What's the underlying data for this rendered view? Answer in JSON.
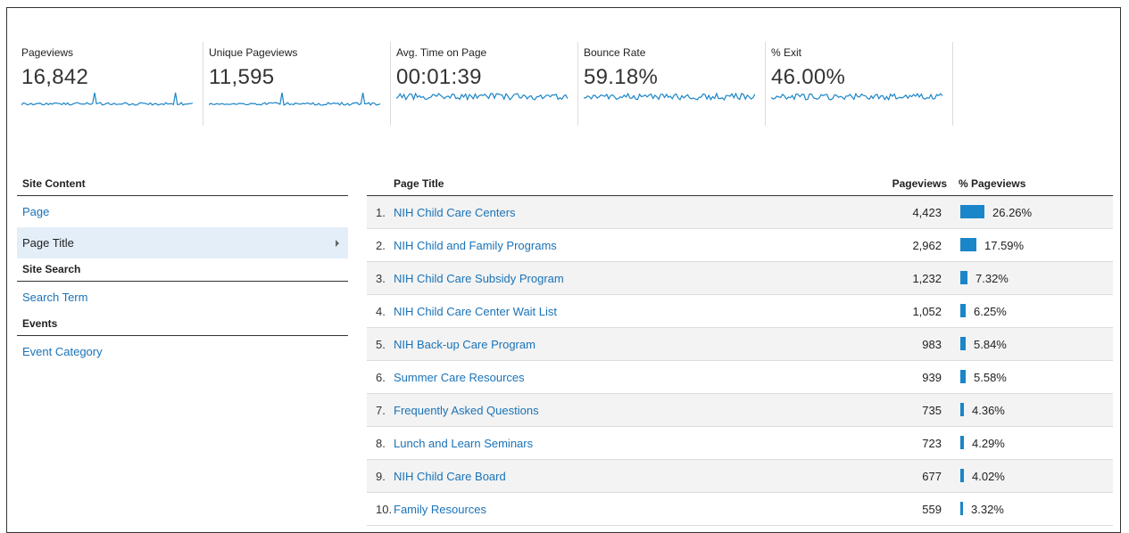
{
  "metrics": [
    {
      "label": "Pageviews",
      "value": "16,842"
    },
    {
      "label": "Unique Pageviews",
      "value": "11,595"
    },
    {
      "label": "Avg. Time on Page",
      "value": "00:01:39"
    },
    {
      "label": "Bounce Rate",
      "value": "59.18%"
    },
    {
      "label": "% Exit",
      "value": "46.00%"
    }
  ],
  "nav": {
    "site_content": "Site Content",
    "page": "Page",
    "page_title": "Page Title",
    "site_search": "Site Search",
    "search_term": "Search Term",
    "events": "Events",
    "event_category": "Event Category"
  },
  "table": {
    "col_title": "Page Title",
    "col_pageviews": "Pageviews",
    "col_pct": "% Pageviews",
    "rows": [
      {
        "num": "1.",
        "title": "NIH Child Care Centers",
        "pageviews": "4,423",
        "pct": "26.26%",
        "share": 26.26
      },
      {
        "num": "2.",
        "title": "NIH Child and Family Programs",
        "pageviews": "2,962",
        "pct": "17.59%",
        "share": 17.59
      },
      {
        "num": "3.",
        "title": "NIH Child Care Subsidy Program",
        "pageviews": "1,232",
        "pct": "7.32%",
        "share": 7.32
      },
      {
        "num": "4.",
        "title": "NIH Child Care Center Wait List",
        "pageviews": "1,052",
        "pct": "6.25%",
        "share": 6.25
      },
      {
        "num": "5.",
        "title": "NIH Back-up Care Program",
        "pageviews": "983",
        "pct": "5.84%",
        "share": 5.84
      },
      {
        "num": "6.",
        "title": "Summer Care Resources",
        "pageviews": "939",
        "pct": "5.58%",
        "share": 5.58
      },
      {
        "num": "7.",
        "title": "Frequently Asked Questions",
        "pageviews": "735",
        "pct": "4.36%",
        "share": 4.36
      },
      {
        "num": "8.",
        "title": "Lunch and Learn Seminars",
        "pageviews": "723",
        "pct": "4.29%",
        "share": 4.29
      },
      {
        "num": "9.",
        "title": "NIH Child Care Board",
        "pageviews": "677",
        "pct": "4.02%",
        "share": 4.02
      },
      {
        "num": "10.",
        "title": "Family Resources",
        "pageviews": "559",
        "pct": "3.32%",
        "share": 3.32
      }
    ]
  },
  "colors": {
    "link": "#1a73b8",
    "bar": "#1a85c8",
    "sparkline": "#1a85c8"
  }
}
